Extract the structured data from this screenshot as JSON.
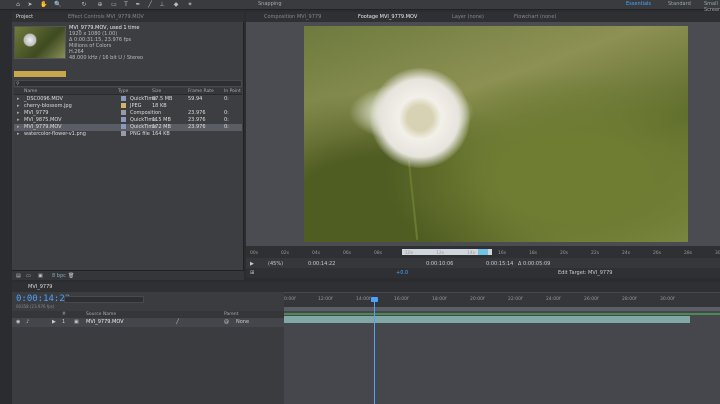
{
  "toolbar": {
    "snapping": "Snapping",
    "workspaces": [
      "Essentials",
      "Standard",
      "Small Screen"
    ]
  },
  "project_panel": {
    "tabs": [
      "Project",
      "Effect Controls MVI_9779.MOV"
    ],
    "selected_item": {
      "name": "MVI_9779.MOV",
      "used": ", used 1 time",
      "resolution": "1920 x 1080 (1.00)",
      "duration": "Δ 0:00:31:15, 23.976 fps",
      "colors": "Millions of Colors",
      "codec": "H.264",
      "audio": "48.000 kHz / 16 bit U / Stereo"
    },
    "columns": [
      "Name",
      "Type",
      "Size",
      "Frame Rate",
      "In Point"
    ],
    "files": [
      {
        "name": "_DSC0096.MOV",
        "type": "QuickTime",
        "size": "87.5 MB",
        "frame_rate": "59.94",
        "in_point": "0:",
        "swatch": "#8a9abf"
      },
      {
        "name": "cherry-blossom.jpg",
        "type": "JPEG",
        "size": "18 KB",
        "frame_rate": "",
        "in_point": "",
        "swatch": "#d3b36a"
      },
      {
        "name": "MVI_9779",
        "type": "Composition",
        "size": "",
        "frame_rate": "23.976",
        "in_point": "0:",
        "swatch": "#9a9aa2"
      },
      {
        "name": "MVI_9875.MOV",
        "type": "QuickTime",
        "size": "115 MB",
        "frame_rate": "23.976",
        "in_point": "0:",
        "swatch": "#8a9abf"
      },
      {
        "name": "MVI_9779.MOV",
        "type": "QuickTime",
        "size": "172 MB",
        "frame_rate": "23.976",
        "in_point": "0:",
        "swatch": "#8a9abf"
      },
      {
        "name": "watercolor-flower-v1.png",
        "type": "PNG file",
        "size": "164 KB",
        "frame_rate": "",
        "in_point": "",
        "swatch": "#9a9aa2"
      }
    ],
    "bpc": "8 bpc"
  },
  "viewer": {
    "tabs": [
      "Composition MVI_9779",
      "Footage MVI_9779.MOV",
      "Layer (none)",
      "Flowchart (none)"
    ],
    "ruler_ticks": [
      "00s",
      "02s",
      "04s",
      "06s",
      "08s",
      "10s",
      "12s",
      "14s",
      "16s",
      "18s",
      "20s",
      "22s",
      "24s",
      "26s",
      "28s",
      "30s"
    ],
    "zoom": "(45%)",
    "current_time": "0:00:14:22",
    "in_time": "0:00:10:06",
    "out_time": "0:00:15:14",
    "duration_time": "Δ 0:00:05:09",
    "offset": "+0.0",
    "edit_target": "Edit Target: MVI_9779"
  },
  "timeline": {
    "tab": "MVI_9779",
    "timecode": "0:00:14:22",
    "timecode_sub": "00358 (23.976 fps)",
    "ticks": [
      "0:00f",
      "12:00f",
      "14:00f",
      "16:00f",
      "18:00f",
      "20:00f",
      "22:00f",
      "24:00f",
      "26:00f",
      "28:00f",
      "30:00f"
    ],
    "columns": [
      "#",
      "Source Name",
      "Parent"
    ],
    "layer": {
      "index": "1",
      "name": "MVI_9779.MOV",
      "parent": "None"
    }
  }
}
